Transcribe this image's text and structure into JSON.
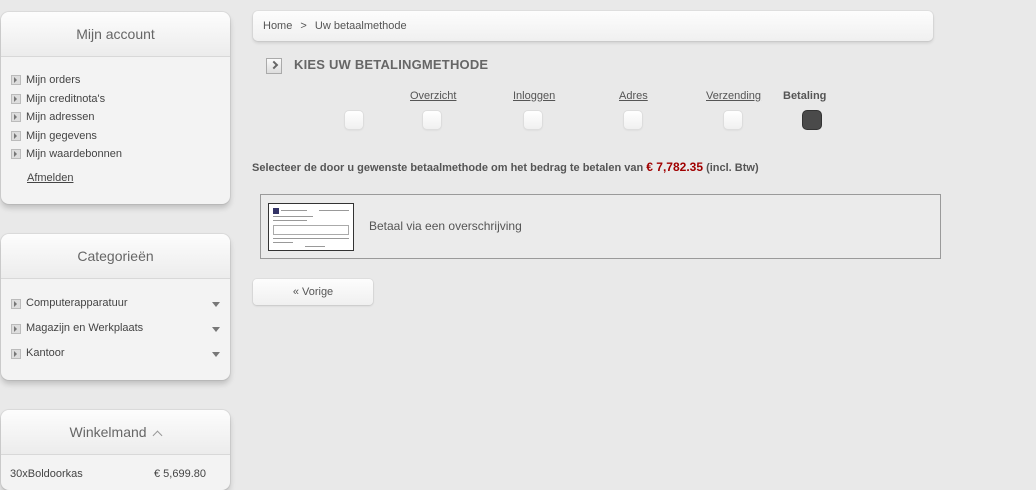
{
  "account": {
    "title": "Mijn account",
    "items": [
      "Mijn orders",
      "Mijn creditnota's",
      "Mijn adressen",
      "Mijn gegevens",
      "Mijn waardebonnen"
    ],
    "logout": "Afmelden"
  },
  "categories": {
    "title": "Categorieën",
    "items": [
      "Computerapparatuur",
      "Magazijn en Werkplaats",
      "Kantoor"
    ]
  },
  "cart": {
    "title": "Winkelmand",
    "item_name": "30xBoldoorkas",
    "item_price": "€ 5,699.80"
  },
  "breadcrumb": {
    "home": "Home",
    "separator": ">",
    "current": "Uw betaalmethode"
  },
  "page_title": "KIES UW BETALINGMETHODE",
  "steps": [
    "Overzicht",
    "Inloggen",
    "Adres",
    "Verzending",
    "Betaling"
  ],
  "instruction": {
    "text": "Selecteer de door u gewenste betaalmethode om het bedrag te betalen van",
    "amount": "€ 7,782.35",
    "suffix": "(incl. Btw)"
  },
  "payment": {
    "label": "Betaal via een overschrijving"
  },
  "prev_button": "« Vorige"
}
